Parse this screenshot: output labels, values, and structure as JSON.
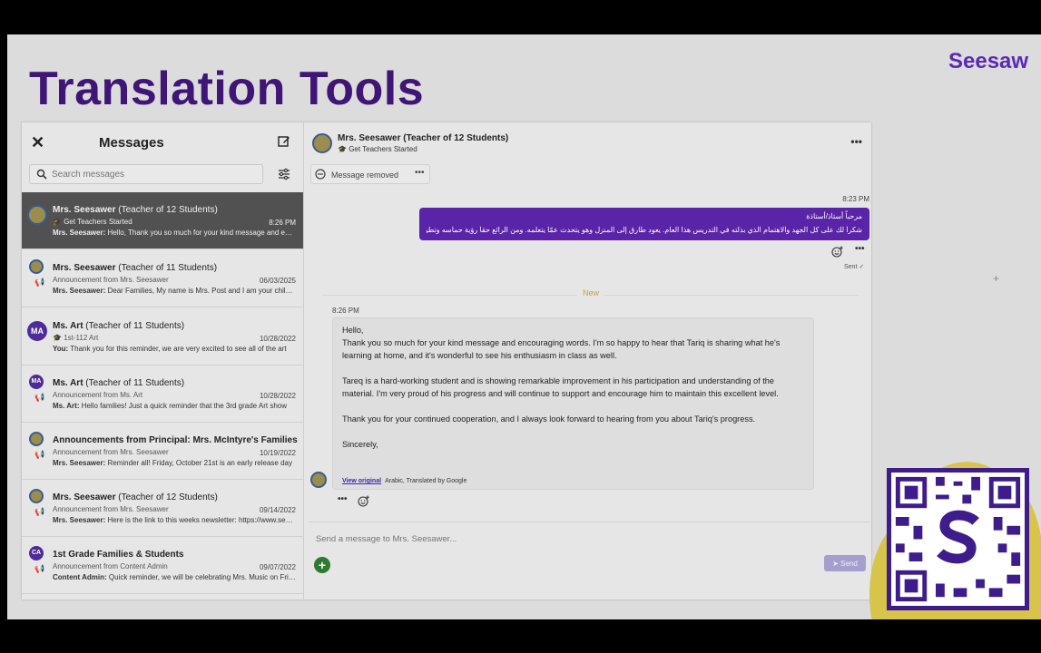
{
  "slide": {
    "title": "Translation Tools",
    "logo": "Seesaw"
  },
  "sidebar": {
    "title": "Messages",
    "search_placeholder": "Search messages",
    "threads": [
      {
        "name": "Mrs. Seesawer",
        "name_suffix": " (Teacher of 12 Students)",
        "sub": "Get Teachers Started",
        "date": "8:26 PM",
        "preview_sender": "Mrs. Seesawer:",
        "preview": " Hello, Thank you so much for your kind message and encouraging words.",
        "active": true
      },
      {
        "name": "Mrs. Seesawer",
        "name_suffix": " (Teacher of 11 Students)",
        "sub": "Announcement from Mrs. Seesawer",
        "date": "06/03/2025",
        "preview_sender": "Mrs. Seesawer:",
        "preview": " Dear Families, My name is Mrs. Post and I am your child's teacher"
      },
      {
        "name": "Ms. Art",
        "name_suffix": " (Teacher of 11 Students)",
        "sub": "1st-112 Art",
        "date": "10/28/2022",
        "preview_sender": "You:",
        "preview": " Thank you for this reminder, we are very excited to see all of the art",
        "avatar": "MA"
      },
      {
        "name": "Ms. Art",
        "name_suffix": " (Teacher of 11 Students)",
        "sub": "Announcement from Ms. Art",
        "date": "10/28/2022",
        "preview_sender": "Ms. Art:",
        "preview": " Hello families! Just a quick reminder that the 3rd grade Art show",
        "avatar": "MA"
      },
      {
        "name": "Announcements from Principal: Mrs. McIntyre's Families",
        "name_suffix": "",
        "sub": "Announcement from Mrs. Seesawer",
        "date": "10/19/2022",
        "preview_sender": "Mrs. Seesawer:",
        "preview": " Reminder all! Friday, October 21st is an early release day"
      },
      {
        "name": "Mrs. Seesawer",
        "name_suffix": " (Teacher of 12 Students)",
        "sub": "Announcement from Mrs. Seesawer",
        "date": "09/14/2022",
        "preview_sender": "Mrs. Seesawer:",
        "preview": " Here is the link to this weeks newsletter: https://www.seesaw.me"
      },
      {
        "name": "1st Grade Families & Students",
        "name_suffix": "",
        "sub": "Announcement from Content Admin",
        "date": "09/07/2022",
        "preview_sender": "Content Admin:",
        "preview": " Quick reminder, we will be celebrating Mrs. Music on Friday",
        "avatar": "CA"
      }
    ]
  },
  "chat": {
    "name": "Mrs. Seesawer (Teacher of 12 Students)",
    "sub": "Get Teachers Started",
    "removed": "Message removed",
    "sent_time": "8:23 PM",
    "sent_line1": "مرحباً أستاذ/أستاذة",
    "sent_line2": "شكراً لك على كل الجهد والاهتمام الذي بذلته في التدريس هذا العام. يعود طارق إلى المنزل وهو يتحدث عمّا يتعلمه. ومن الرائع حقاً رؤية حماسه وتطوره",
    "sent_status": "Sent ✓",
    "new_label": "New",
    "recv_time": "8:26 PM",
    "recv_p1": "Hello,",
    "recv_p2": "Thank you so much for your kind message and encouraging words. I'm so happy to hear that Tariq is sharing what he's learning at home, and it's wonderful to see his enthusiasm in class as well.",
    "recv_p3": "Tareq is a hard-working student and is showing remarkable improvement in his participation and understanding of the material. I'm very proud of his progress and will continue to support and encourage him to maintain this excellent level.",
    "recv_p4": "Thank you for your continued cooperation, and I always look forward to hearing from you about Tariq's progress.",
    "recv_p5": "Sincerely,",
    "view_original": "View original",
    "translated_note": "Arabic, Translated by Google",
    "compose_placeholder": "Send a message to Mrs. Seesawer...",
    "send_label": "Send"
  }
}
